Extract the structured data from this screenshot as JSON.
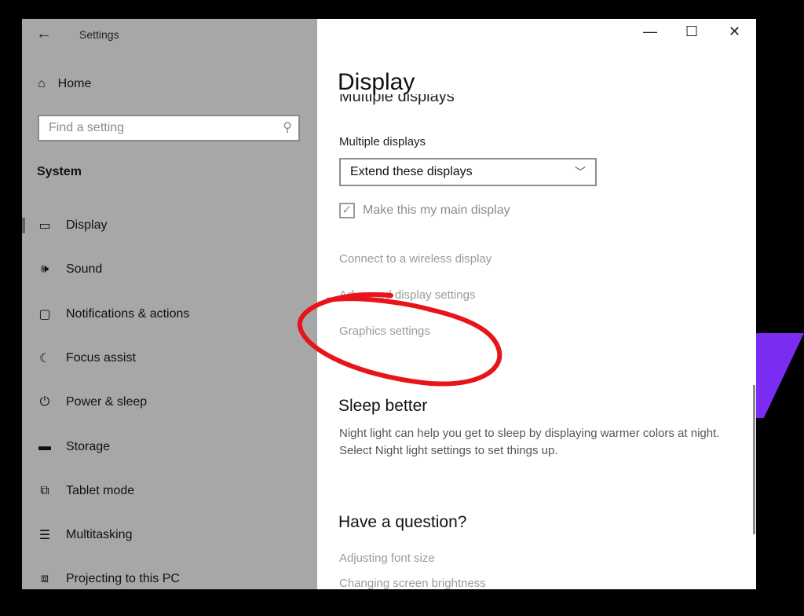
{
  "window": {
    "app_title": "Settings",
    "controls": {
      "minimize": "—",
      "maximize": "☐",
      "close": "✕"
    }
  },
  "sidebar": {
    "home": "Home",
    "search_placeholder": "Find a setting",
    "section": "System",
    "items": [
      {
        "label": "Display",
        "icon": "monitor-icon",
        "selected": true
      },
      {
        "label": "Sound",
        "icon": "speaker-icon"
      },
      {
        "label": "Notifications & actions",
        "icon": "message-icon"
      },
      {
        "label": "Focus assist",
        "icon": "moon-icon"
      },
      {
        "label": "Power & sleep",
        "icon": "power-icon"
      },
      {
        "label": "Storage",
        "icon": "storage-icon"
      },
      {
        "label": "Tablet mode",
        "icon": "tablet-icon"
      },
      {
        "label": "Multitasking",
        "icon": "multitasking-icon"
      },
      {
        "label": "Projecting to this PC",
        "icon": "projecting-icon"
      }
    ]
  },
  "main": {
    "title": "Display",
    "section_heading": "Multiple displays",
    "multiple_displays_label": "Multiple displays",
    "multiple_displays_value": "Extend these displays",
    "main_display_checkbox": {
      "label": "Make this my main display",
      "checked": true
    },
    "links": [
      "Connect to a wireless display",
      "Advanced display settings",
      "Graphics settings"
    ],
    "sleep": {
      "heading": "Sleep better",
      "text": "Night light can help you get to sleep by displaying warmer colors at night. Select Night light settings to set things up."
    },
    "question": {
      "heading": "Have a question?",
      "links": [
        "Adjusting font size",
        "Changing screen brightness"
      ]
    }
  },
  "colors": {
    "annotation": "#e8141a",
    "sidebar_bg": "#a7a7a7",
    "purple": "#7a2cf2"
  }
}
